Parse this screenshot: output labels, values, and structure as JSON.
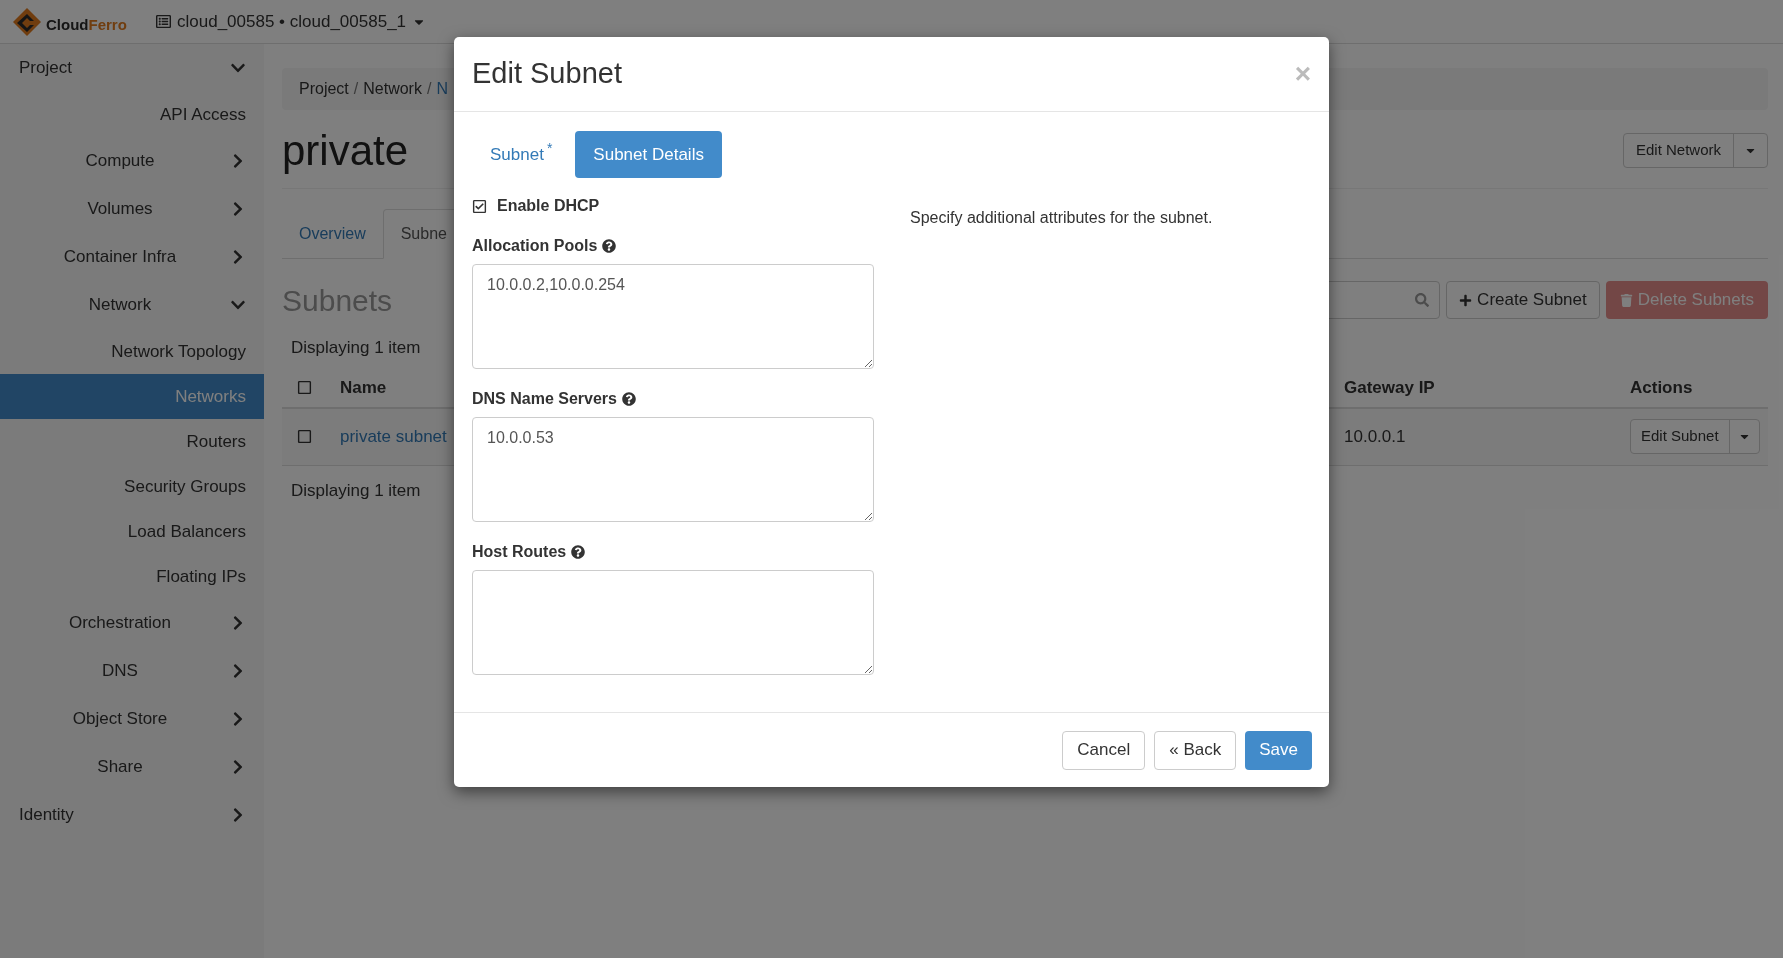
{
  "topbar": {
    "brand_parts": [
      "Cloud",
      "Ferro"
    ],
    "project_switcher": "cloud_00585 • cloud_00585_1"
  },
  "sidebar": {
    "items": [
      {
        "label": "Project",
        "kind": "section",
        "expanded": true,
        "children": [
          {
            "label": "API Access",
            "kind": "link",
            "selected": false
          },
          {
            "label": "Compute",
            "kind": "group",
            "expanded": false
          },
          {
            "label": "Volumes",
            "kind": "group",
            "expanded": false
          },
          {
            "label": "Container Infra",
            "kind": "group",
            "expanded": false
          },
          {
            "label": "Network",
            "kind": "group",
            "expanded": true,
            "children": [
              {
                "label": "Network Topology",
                "kind": "link",
                "selected": false
              },
              {
                "label": "Networks",
                "kind": "link",
                "selected": true
              },
              {
                "label": "Routers",
                "kind": "link",
                "selected": false
              },
              {
                "label": "Security Groups",
                "kind": "link",
                "selected": false
              },
              {
                "label": "Load Balancers",
                "kind": "link",
                "selected": false
              },
              {
                "label": "Floating IPs",
                "kind": "link",
                "selected": false
              }
            ]
          },
          {
            "label": "Orchestration",
            "kind": "group",
            "expanded": false
          },
          {
            "label": "DNS",
            "kind": "group",
            "expanded": false
          },
          {
            "label": "Object Store",
            "kind": "group",
            "expanded": false
          },
          {
            "label": "Share",
            "kind": "group",
            "expanded": false
          }
        ]
      },
      {
        "label": "Identity",
        "kind": "section",
        "expanded": false
      }
    ]
  },
  "breadcrumb": {
    "separator": "/",
    "items": [
      {
        "label": "Project",
        "link": false
      },
      {
        "label": "Network",
        "link": false
      },
      {
        "label": "N",
        "link": true
      }
    ]
  },
  "page": {
    "title": "private",
    "edit_button": "Edit Network",
    "tabs": [
      {
        "label": "Overview",
        "selected": false
      },
      {
        "label": "Subne",
        "selected": true
      }
    ],
    "section_title": "Subnets",
    "create_button": "Create Subnet",
    "delete_button": {
      "label": "Delete Subnets",
      "disabled": true
    },
    "count_top": "Displaying 1 item",
    "count_bottom": "Displaying 1 item",
    "table": {
      "select_all_checked": false,
      "columns": [
        "Name",
        "Gateway IP",
        "Actions"
      ],
      "rows": [
        {
          "checked": false,
          "name": "private subnet",
          "gateway_ip": "10.0.0.1",
          "action": "Edit Subnet"
        }
      ]
    }
  },
  "dialog": {
    "title": "Edit Subnet",
    "close": "×",
    "tabs": [
      {
        "label": "Subnet",
        "marker": "*",
        "selected": false
      },
      {
        "label": "Subnet Details",
        "selected": true
      }
    ],
    "enable_dhcp": {
      "label": "Enable DHCP",
      "checked": true
    },
    "fields": [
      {
        "label": "Allocation Pools",
        "value": "10.0.0.2,10.0.0.254"
      },
      {
        "label": "DNS Name Servers",
        "value": "10.0.0.53"
      },
      {
        "label": "Host Routes"
      }
    ],
    "help_text": "Specify additional attributes for the subnet.",
    "buttons": [
      {
        "label": "Cancel",
        "kind": "default"
      },
      {
        "label": "« Back",
        "kind": "default"
      },
      {
        "label": "Save",
        "kind": "primary"
      }
    ]
  }
}
